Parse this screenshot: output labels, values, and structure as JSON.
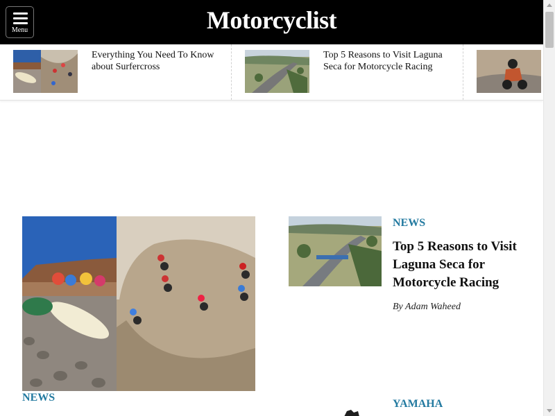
{
  "header": {
    "logo": "Motorcyclist",
    "menu_label": "Menu",
    "menu_icon": "hamburger-icon"
  },
  "trending": [
    {
      "title": "Everything You Need To Know about Surfercross"
    },
    {
      "title": "Top 5 Reasons to Visit Laguna Seca for Motorcycle Racing"
    },
    {
      "title": ""
    }
  ],
  "feature": {
    "tag": "NEWS"
  },
  "side_story": {
    "tag": "NEWS",
    "title": "Top 5 Reasons to Visit Laguna Seca for Motorcycle Racing",
    "byline": "By Adam Waheed"
  },
  "next_story": {
    "tag": "YAMAHA"
  },
  "colors": {
    "header_bg": "#000000",
    "tag": "#237aa0",
    "text": "#111111"
  }
}
